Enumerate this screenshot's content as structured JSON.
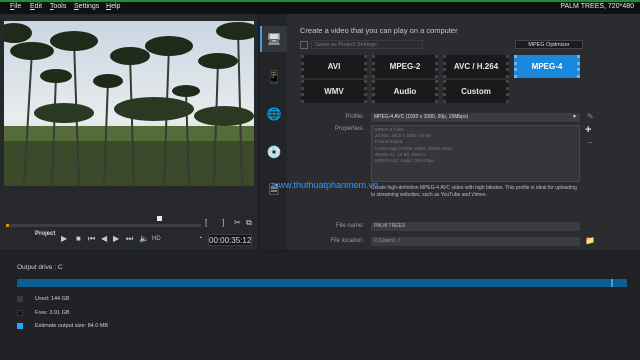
{
  "menu": [
    "File",
    "Edit",
    "Tools",
    "Settings",
    "Help"
  ],
  "project_title": "PALM TREES, 720*480",
  "preview": {
    "label": "Project",
    "hd_label": "HD",
    "timecode": "00:00:35:12"
  },
  "format": {
    "title": "Create a video that you can play on a computer",
    "same_as_label": "Same as Project Settings",
    "optimizer_label": "MPEG Optimizer",
    "buttons": [
      {
        "label": "AVI",
        "active": false
      },
      {
        "label": "MPEG-2",
        "active": false
      },
      {
        "label": "AVC / H.264",
        "active": false
      },
      {
        "label": "MPEG-4",
        "active": true
      },
      {
        "label": "WMV",
        "active": false
      },
      {
        "label": "Audio",
        "active": false
      },
      {
        "label": "Custom",
        "active": false
      }
    ],
    "profile_label": "Profile:",
    "profile_value": "MPEG-4 AVC (1920 x 1080, 30p, 15Mbps)",
    "properties_label": "Properties:",
    "properties": [
      "MPEG-4 Files",
      "24 bits, 1920 x 1080, 30 fps",
      "Frame-based",
      "H.264 High Profile Video: 15000 Kbps",
      "48000 Hz, 16 Bit, Stereo",
      "MPEG AAC Audio: 256 Kbps"
    ],
    "description": "Create high-definition MPEG-4 AVC video with high bitrates. This profile is ideal for uploading to streaming websites, such as YouTube and Vimeo.",
    "watermark": "www.thuthuatphanmem.vn",
    "file_name_label": "File name:",
    "file_name_value": "PALM TREES",
    "file_location_label": "File location:",
    "file_location_value": "C:\\Users\\...\\"
  },
  "output": {
    "drive_label": "Output drive : C",
    "used_fraction": 0.974,
    "used_label": "Used:  144 GB",
    "free_label": "Free:  3.91 GB",
    "estimate_label": "Estimate output size:  84.0 MB",
    "colors": {
      "used": "#3a3c40",
      "free": "#1a1b1d",
      "estimate": "#2aa3ff",
      "bar": "#0c5f8e"
    }
  }
}
